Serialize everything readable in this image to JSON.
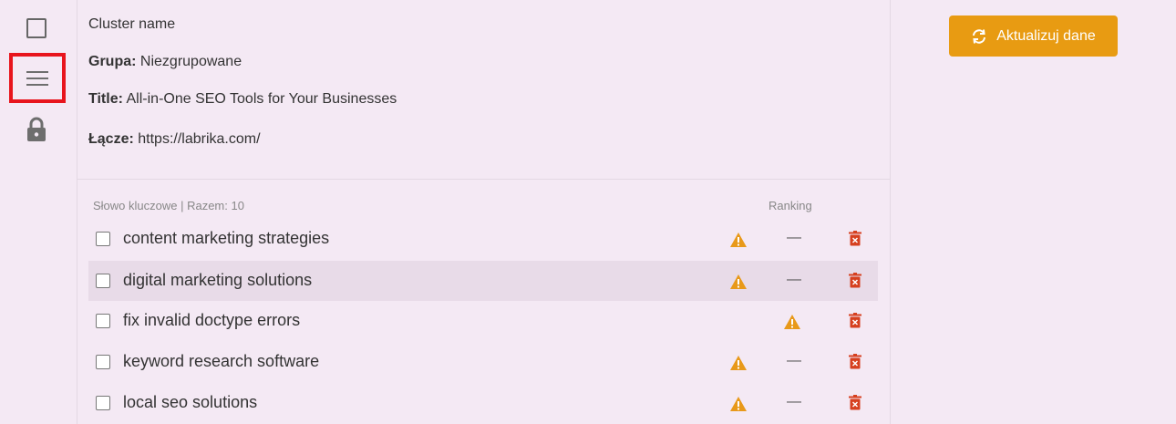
{
  "sidebar": {
    "icons": [
      "checkbox-icon",
      "menu-icon",
      "lock-icon"
    ],
    "highlight_color": "#e8151d"
  },
  "info": {
    "cluster_name": "Cluster name",
    "group_label": "Grupa:",
    "group_value": "Niezgrupowane",
    "title_label": "Title:",
    "title_value": "All-in-One SEO Tools for Your Businesses",
    "link_label": "Łącze:",
    "link_value": "https://labrika.com/"
  },
  "table": {
    "header_keyword": "Słowo kluczowe | Razem: 10",
    "header_ranking": "Ranking",
    "rows": [
      {
        "keyword": "content marketing strategies",
        "ranking": "—",
        "warning": true
      },
      {
        "keyword": "digital marketing solutions",
        "ranking": "—",
        "warning": true
      },
      {
        "keyword": "fix invalid doctype errors",
        "ranking": "",
        "warning": true
      },
      {
        "keyword": "keyword research software",
        "ranking": "—",
        "warning": true
      },
      {
        "keyword": "local seo solutions",
        "ranking": "—",
        "warning": true
      }
    ]
  },
  "actions": {
    "refresh_label": "Aktualizuj dane",
    "accent_color": "#e89b12"
  },
  "colors": {
    "warning": "#e8991a",
    "delete": "#d6401f",
    "background": "#f4e9f4",
    "row_highlight": "#e8dbe8"
  }
}
